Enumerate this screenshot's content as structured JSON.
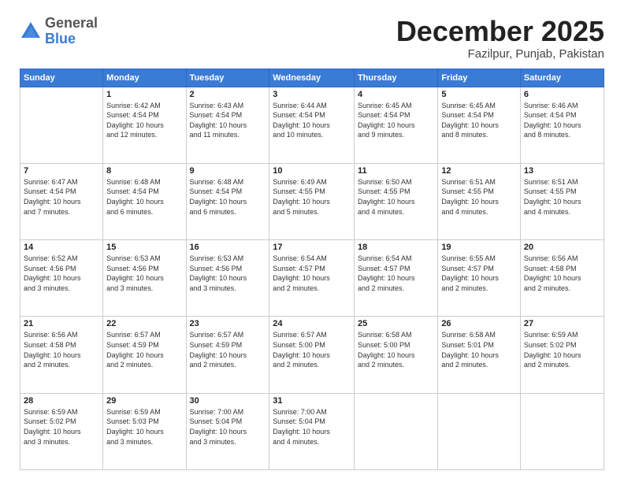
{
  "logo": {
    "general": "General",
    "blue": "Blue"
  },
  "title": "December 2025",
  "subtitle": "Fazilpur, Punjab, Pakistan",
  "days_of_week": [
    "Sunday",
    "Monday",
    "Tuesday",
    "Wednesday",
    "Thursday",
    "Friday",
    "Saturday"
  ],
  "weeks": [
    [
      {
        "day": "",
        "info": ""
      },
      {
        "day": "1",
        "info": "Sunrise: 6:42 AM\nSunset: 4:54 PM\nDaylight: 10 hours\nand 12 minutes."
      },
      {
        "day": "2",
        "info": "Sunrise: 6:43 AM\nSunset: 4:54 PM\nDaylight: 10 hours\nand 11 minutes."
      },
      {
        "day": "3",
        "info": "Sunrise: 6:44 AM\nSunset: 4:54 PM\nDaylight: 10 hours\nand 10 minutes."
      },
      {
        "day": "4",
        "info": "Sunrise: 6:45 AM\nSunset: 4:54 PM\nDaylight: 10 hours\nand 9 minutes."
      },
      {
        "day": "5",
        "info": "Sunrise: 6:45 AM\nSunset: 4:54 PM\nDaylight: 10 hours\nand 8 minutes."
      },
      {
        "day": "6",
        "info": "Sunrise: 6:46 AM\nSunset: 4:54 PM\nDaylight: 10 hours\nand 8 minutes."
      }
    ],
    [
      {
        "day": "7",
        "info": "Sunrise: 6:47 AM\nSunset: 4:54 PM\nDaylight: 10 hours\nand 7 minutes."
      },
      {
        "day": "8",
        "info": "Sunrise: 6:48 AM\nSunset: 4:54 PM\nDaylight: 10 hours\nand 6 minutes."
      },
      {
        "day": "9",
        "info": "Sunrise: 6:48 AM\nSunset: 4:54 PM\nDaylight: 10 hours\nand 6 minutes."
      },
      {
        "day": "10",
        "info": "Sunrise: 6:49 AM\nSunset: 4:55 PM\nDaylight: 10 hours\nand 5 minutes."
      },
      {
        "day": "11",
        "info": "Sunrise: 6:50 AM\nSunset: 4:55 PM\nDaylight: 10 hours\nand 4 minutes."
      },
      {
        "day": "12",
        "info": "Sunrise: 6:51 AM\nSunset: 4:55 PM\nDaylight: 10 hours\nand 4 minutes."
      },
      {
        "day": "13",
        "info": "Sunrise: 6:51 AM\nSunset: 4:55 PM\nDaylight: 10 hours\nand 4 minutes."
      }
    ],
    [
      {
        "day": "14",
        "info": "Sunrise: 6:52 AM\nSunset: 4:56 PM\nDaylight: 10 hours\nand 3 minutes."
      },
      {
        "day": "15",
        "info": "Sunrise: 6:53 AM\nSunset: 4:56 PM\nDaylight: 10 hours\nand 3 minutes."
      },
      {
        "day": "16",
        "info": "Sunrise: 6:53 AM\nSunset: 4:56 PM\nDaylight: 10 hours\nand 3 minutes."
      },
      {
        "day": "17",
        "info": "Sunrise: 6:54 AM\nSunset: 4:57 PM\nDaylight: 10 hours\nand 2 minutes."
      },
      {
        "day": "18",
        "info": "Sunrise: 6:54 AM\nSunset: 4:57 PM\nDaylight: 10 hours\nand 2 minutes."
      },
      {
        "day": "19",
        "info": "Sunrise: 6:55 AM\nSunset: 4:57 PM\nDaylight: 10 hours\nand 2 minutes."
      },
      {
        "day": "20",
        "info": "Sunrise: 6:56 AM\nSunset: 4:58 PM\nDaylight: 10 hours\nand 2 minutes."
      }
    ],
    [
      {
        "day": "21",
        "info": "Sunrise: 6:56 AM\nSunset: 4:58 PM\nDaylight: 10 hours\nand 2 minutes."
      },
      {
        "day": "22",
        "info": "Sunrise: 6:57 AM\nSunset: 4:59 PM\nDaylight: 10 hours\nand 2 minutes."
      },
      {
        "day": "23",
        "info": "Sunrise: 6:57 AM\nSunset: 4:59 PM\nDaylight: 10 hours\nand 2 minutes."
      },
      {
        "day": "24",
        "info": "Sunrise: 6:57 AM\nSunset: 5:00 PM\nDaylight: 10 hours\nand 2 minutes."
      },
      {
        "day": "25",
        "info": "Sunrise: 6:58 AM\nSunset: 5:00 PM\nDaylight: 10 hours\nand 2 minutes."
      },
      {
        "day": "26",
        "info": "Sunrise: 6:58 AM\nSunset: 5:01 PM\nDaylight: 10 hours\nand 2 minutes."
      },
      {
        "day": "27",
        "info": "Sunrise: 6:59 AM\nSunset: 5:02 PM\nDaylight: 10 hours\nand 2 minutes."
      }
    ],
    [
      {
        "day": "28",
        "info": "Sunrise: 6:59 AM\nSunset: 5:02 PM\nDaylight: 10 hours\nand 3 minutes."
      },
      {
        "day": "29",
        "info": "Sunrise: 6:59 AM\nSunset: 5:03 PM\nDaylight: 10 hours\nand 3 minutes."
      },
      {
        "day": "30",
        "info": "Sunrise: 7:00 AM\nSunset: 5:04 PM\nDaylight: 10 hours\nand 3 minutes."
      },
      {
        "day": "31",
        "info": "Sunrise: 7:00 AM\nSunset: 5:04 PM\nDaylight: 10 hours\nand 4 minutes."
      },
      {
        "day": "",
        "info": ""
      },
      {
        "day": "",
        "info": ""
      },
      {
        "day": "",
        "info": ""
      }
    ]
  ]
}
